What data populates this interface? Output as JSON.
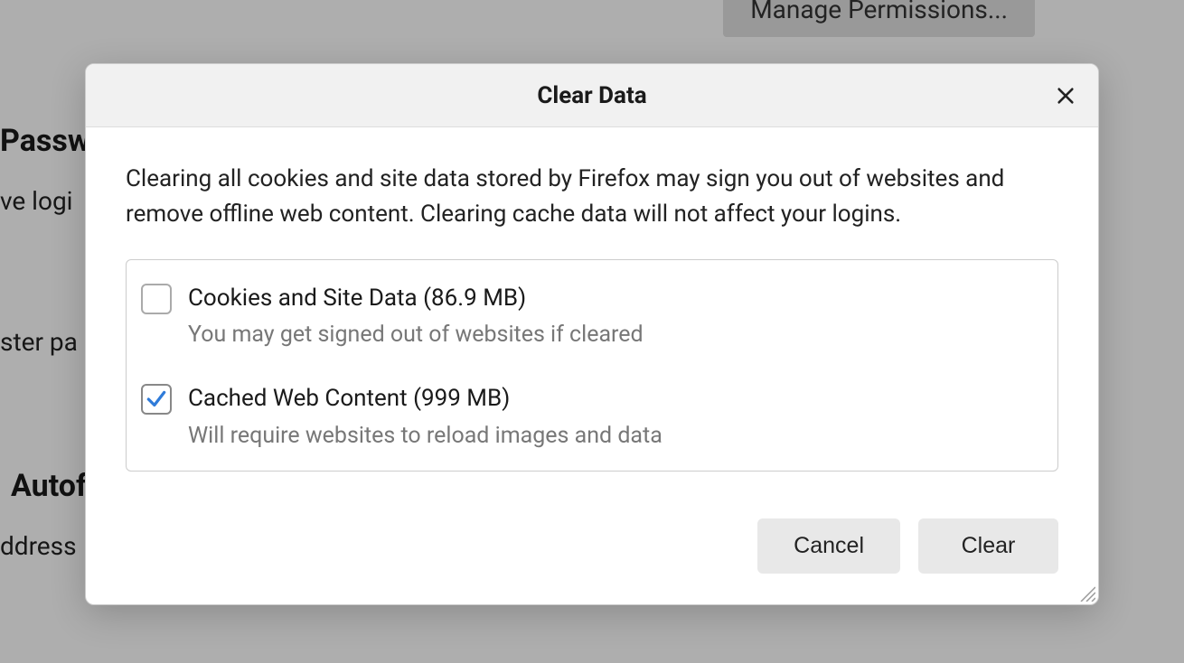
{
  "background": {
    "managePermissions": "Manage Permissions...",
    "passwordsHeading": "Passwords",
    "saveLogins": "ve logi",
    "masterPassword": "ster pa",
    "autofillHeading": "Autof",
    "address": "ddress"
  },
  "dialog": {
    "title": "Clear Data",
    "description": "Clearing all cookies and site data stored by Firefox may sign you out of websites and remove offline web content. Clearing cache data will not affect your logins.",
    "options": {
      "cookies": {
        "label": "Cookies and Site Data (86.9 MB)",
        "sub": "You may get signed out of websites if cleared",
        "checked": false
      },
      "cache": {
        "label": "Cached Web Content (999 MB)",
        "sub": "Will require websites to reload images and data",
        "checked": true
      }
    },
    "buttons": {
      "cancel": "Cancel",
      "clear": "Clear"
    }
  }
}
